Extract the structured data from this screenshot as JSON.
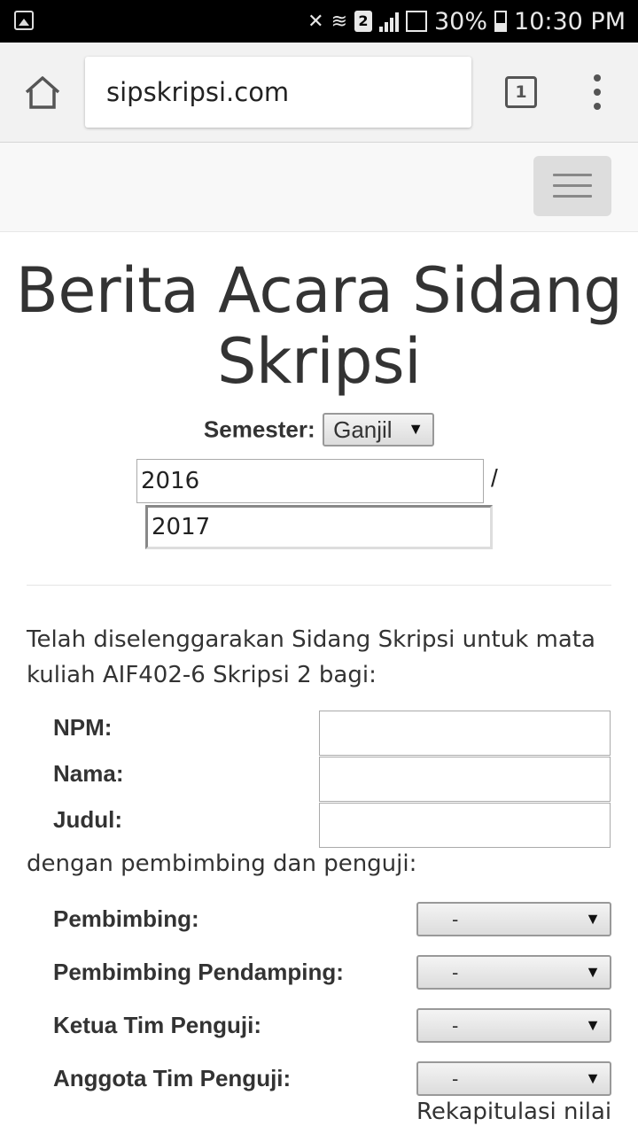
{
  "status_bar": {
    "battery_percent": "30%",
    "time": "10:30 PM",
    "sim_slot": "2",
    "icons": [
      "gallery-icon",
      "vibrate-mute-icon",
      "wifi-icon",
      "signal-icon",
      "signal-icon",
      "battery-icon"
    ]
  },
  "browser": {
    "url": "sipskripsi.com",
    "tab_count": "1",
    "icons": [
      "home-icon",
      "tabs-icon",
      "overflow-menu-icon"
    ]
  },
  "navbar": {
    "toggle_icon": "hamburger-icon"
  },
  "page": {
    "title": "Berita Acara Sidang Skripsi",
    "semester_label": "Semester:",
    "semester_value": "Ganjil",
    "year_start": "2016",
    "year_separator": "/",
    "year_end": "2017",
    "intro": "Telah diselenggarakan Sidang Skripsi untuk mata kuliah AIF402-6 Skripsi 2 bagi:",
    "fields": {
      "npm_label": "NPM:",
      "nama_label": "Nama:",
      "judul_label": "Judul:"
    },
    "examiners_intro": "dengan pembimbing dan penguji:",
    "examiners": [
      {
        "label": "Pembimbing:",
        "value": "-"
      },
      {
        "label": "Pembimbing Pendamping:",
        "value": "-"
      },
      {
        "label": "Ketua Tim Penguji:",
        "value": "-"
      },
      {
        "label": "Anggota Tim Penguji:",
        "value": "-"
      }
    ],
    "recap_text": "Rekapitulasi nilai"
  }
}
